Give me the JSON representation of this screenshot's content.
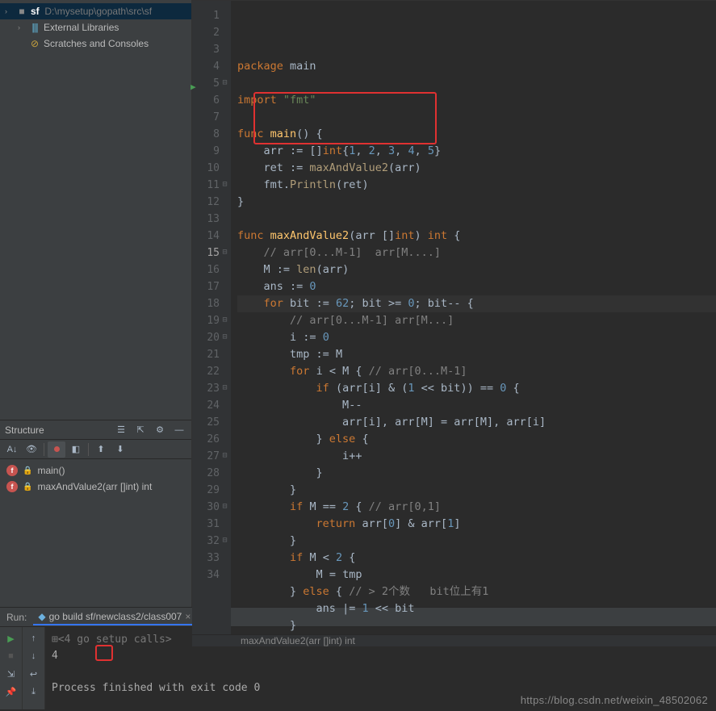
{
  "project_tree": {
    "sf_label": "sf",
    "sf_path": "D:\\mysetup\\gopath\\src\\sf",
    "external_libs": "External Libraries",
    "scratches": "Scratches and Consoles"
  },
  "structure": {
    "title": "Structure",
    "items": [
      {
        "label": "main()"
      },
      {
        "label": "maxAndValue2(arr []int) int"
      }
    ]
  },
  "editor": {
    "breadcrumb": "maxAndValue2(arr []int) int",
    "lines": [
      {
        "n": 1,
        "html": "<span class='c-kw'>package</span> <span class='c-ident'>main</span>"
      },
      {
        "n": 2,
        "html": ""
      },
      {
        "n": 3,
        "html": "<span class='c-kw'>import</span> <span class='c-str'>\"fmt\"</span>"
      },
      {
        "n": 4,
        "html": ""
      },
      {
        "n": 5,
        "html": "<span class='c-kw'>func</span> <span class='c-fn'>main</span>() {"
      },
      {
        "n": 6,
        "html": "    <span class='c-ident'>arr</span> := []<span class='c-type'>int</span>{<span class='c-num'>1</span>, <span class='c-num'>2</span>, <span class='c-num'>3</span>, <span class='c-num'>4</span>, <span class='c-num'>5</span>}"
      },
      {
        "n": 7,
        "html": "    <span class='c-ident'>ret</span> := <span class='c-call'>maxAndValue2</span>(<span class='c-ident'>arr</span>)"
      },
      {
        "n": 8,
        "html": "    <span class='c-ident'>fmt</span>.<span class='c-call'>Println</span>(<span class='c-ident'>ret</span>)"
      },
      {
        "n": 9,
        "html": "}"
      },
      {
        "n": 10,
        "html": ""
      },
      {
        "n": 11,
        "html": "<span class='c-kw'>func</span> <span class='c-fn'>maxAndValue2</span>(<span class='c-ident'>arr</span> []<span class='c-type'>int</span>) <span class='c-type'>int</span> {"
      },
      {
        "n": 12,
        "html": "    <span class='c-cmt'>// arr[0...M-1]  arr[M....]</span>"
      },
      {
        "n": 13,
        "html": "    <span class='c-ident'>M</span> := <span class='c-call'>len</span>(<span class='c-ident'>arr</span>)"
      },
      {
        "n": 14,
        "html": "    <span class='c-ident'>ans</span> := <span class='c-num'>0</span>"
      },
      {
        "n": 15,
        "html": "    <span class='c-kw'>for</span> <span class='c-ident'>bit</span> := <span class='c-num'>62</span>; <span class='c-ident'>bit</span> &gt;= <span class='c-num'>0</span>; <span class='c-ident'>bit</span>-- {",
        "current": true
      },
      {
        "n": 16,
        "html": "        <span class='c-cmt'>// arr[0...M-1] arr[M...]</span>"
      },
      {
        "n": 17,
        "html": "        <span class='c-ident'>i</span> := <span class='c-num'>0</span>"
      },
      {
        "n": 18,
        "html": "        <span class='c-ident'>tmp</span> := <span class='c-ident'>M</span>"
      },
      {
        "n": 19,
        "html": "        <span class='c-kw'>for</span> <span class='c-ident'>i</span> &lt; <span class='c-ident'>M</span> { <span class='c-cmt'>// arr[0...M-1]</span>"
      },
      {
        "n": 20,
        "html": "            <span class='c-kw'>if</span> (<span class='c-ident'>arr</span>[<span class='c-ident'>i</span>] &amp; (<span class='c-num'>1</span> &lt;&lt; <span class='c-ident'>bit</span>)) == <span class='c-num'>0</span> {"
      },
      {
        "n": 21,
        "html": "                <span class='c-ident'>M</span>--"
      },
      {
        "n": 22,
        "html": "                <span class='c-ident'>arr</span>[<span class='c-ident'>i</span>], <span class='c-ident'>arr</span>[<span class='c-ident'>M</span>] = <span class='c-ident'>arr</span>[<span class='c-ident'>M</span>], <span class='c-ident'>arr</span>[<span class='c-ident'>i</span>]"
      },
      {
        "n": 23,
        "html": "            } <span class='c-kw'>else</span> {"
      },
      {
        "n": 24,
        "html": "                <span class='c-ident'>i</span>++"
      },
      {
        "n": 25,
        "html": "            }"
      },
      {
        "n": 26,
        "html": "        }"
      },
      {
        "n": 27,
        "html": "        <span class='c-kw'>if</span> <span class='c-ident'>M</span> == <span class='c-num'>2</span> { <span class='c-cmt'>// arr[0,1]</span>"
      },
      {
        "n": 28,
        "html": "            <span class='c-kw'>return</span> <span class='c-ident'>arr</span>[<span class='c-num'>0</span>] &amp; <span class='c-ident'>arr</span>[<span class='c-num'>1</span>]"
      },
      {
        "n": 29,
        "html": "        }"
      },
      {
        "n": 30,
        "html": "        <span class='c-kw'>if</span> <span class='c-ident'>M</span> &lt; <span class='c-num'>2</span> {"
      },
      {
        "n": 31,
        "html": "            <span class='c-ident'>M</span> = <span class='c-ident'>tmp</span>"
      },
      {
        "n": 32,
        "html": "        } <span class='c-kw'>else</span> { <span class='c-cmt'>// &gt; 2个数   bit位上有1</span>"
      },
      {
        "n": 33,
        "html": "            <span class='c-ident'>ans</span> |= <span class='c-num'>1</span> &lt;&lt; <span class='c-ident'>bit</span>"
      },
      {
        "n": 34,
        "html": "        }"
      }
    ]
  },
  "run": {
    "label": "Run:",
    "tab_label": "go build sf/newclass2/class007",
    "console_lines": [
      {
        "text": "<4 go setup calls>",
        "dim": true,
        "prefix": "⊞"
      },
      {
        "text": "4",
        "boxed": true
      },
      {
        "text": ""
      },
      {
        "text": "Process finished with exit code 0"
      }
    ]
  },
  "watermark": "https://blog.csdn.net/weixin_48502062"
}
